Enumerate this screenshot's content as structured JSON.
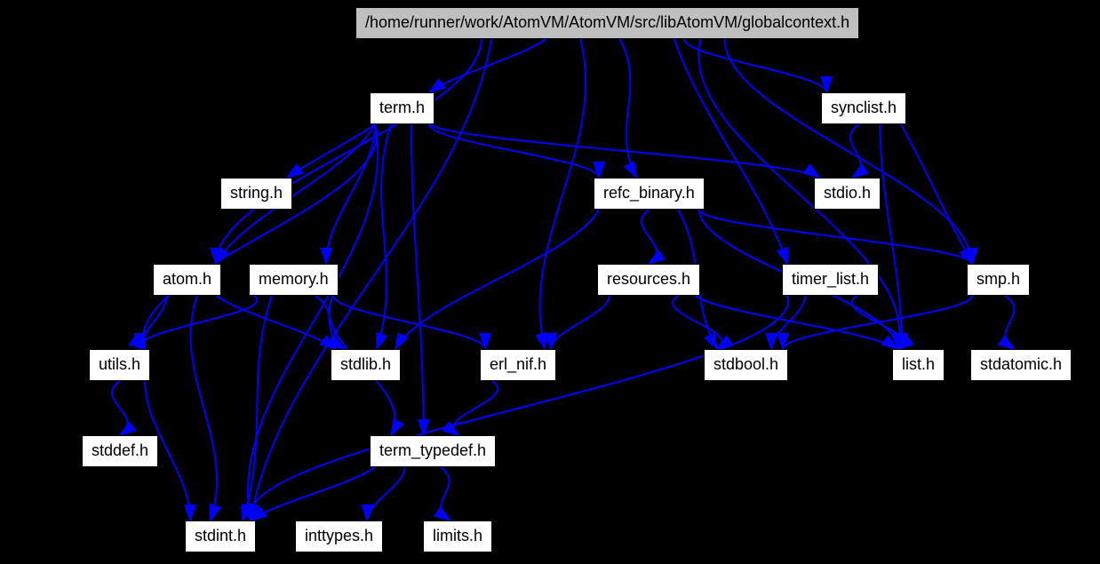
{
  "nodes": {
    "root": {
      "label": "/home/runner/work/AtomVM/AtomVM/src/libAtomVM/globalcontext.h"
    },
    "term": {
      "label": "term.h"
    },
    "synclist": {
      "label": "synclist.h"
    },
    "string": {
      "label": "string.h"
    },
    "refc_binary": {
      "label": "refc_binary.h"
    },
    "stdio": {
      "label": "stdio.h"
    },
    "atom": {
      "label": "atom.h"
    },
    "memory": {
      "label": "memory.h"
    },
    "resources": {
      "label": "resources.h"
    },
    "timer_list": {
      "label": "timer_list.h"
    },
    "smp": {
      "label": "smp.h"
    },
    "utils": {
      "label": "utils.h"
    },
    "stdlib": {
      "label": "stdlib.h"
    },
    "erl_nif": {
      "label": "erl_nif.h"
    },
    "stdbool": {
      "label": "stdbool.h"
    },
    "list": {
      "label": "list.h"
    },
    "stdatomic": {
      "label": "stdatomic.h"
    },
    "stddef": {
      "label": "stddef.h"
    },
    "term_typedef": {
      "label": "term_typedef.h"
    },
    "stdint": {
      "label": "stdint.h"
    },
    "inttypes": {
      "label": "inttypes.h"
    },
    "limits": {
      "label": "limits.h"
    }
  },
  "edges": [
    [
      "root",
      "term"
    ],
    [
      "root",
      "synclist"
    ],
    [
      "root",
      "refc_binary"
    ],
    [
      "root",
      "stdint"
    ],
    [
      "root",
      "atom"
    ],
    [
      "root",
      "erl_nif"
    ],
    [
      "root",
      "list"
    ],
    [
      "root",
      "smp"
    ],
    [
      "root",
      "timer_list"
    ],
    [
      "term",
      "string"
    ],
    [
      "term",
      "refc_binary"
    ],
    [
      "term",
      "stdio"
    ],
    [
      "term",
      "atom"
    ],
    [
      "term",
      "memory"
    ],
    [
      "term",
      "utils"
    ],
    [
      "term",
      "stdlib"
    ],
    [
      "term",
      "term_typedef"
    ],
    [
      "term",
      "stdint"
    ],
    [
      "synclist",
      "stdio"
    ],
    [
      "synclist",
      "list"
    ],
    [
      "synclist",
      "smp"
    ],
    [
      "refc_binary",
      "resources"
    ],
    [
      "refc_binary",
      "list"
    ],
    [
      "refc_binary",
      "stdbool"
    ],
    [
      "refc_binary",
      "stdlib"
    ],
    [
      "refc_binary",
      "smp"
    ],
    [
      "atom",
      "stdlib"
    ],
    [
      "atom",
      "stdint"
    ],
    [
      "atom",
      "utils"
    ],
    [
      "memory",
      "stdlib"
    ],
    [
      "memory",
      "stdint"
    ],
    [
      "memory",
      "erl_nif"
    ],
    [
      "memory",
      "utils"
    ],
    [
      "memory",
      "term_typedef"
    ],
    [
      "resources",
      "erl_nif"
    ],
    [
      "resources",
      "list"
    ],
    [
      "resources",
      "stdbool"
    ],
    [
      "timer_list",
      "stdbool"
    ],
    [
      "timer_list",
      "stdint"
    ],
    [
      "timer_list",
      "list"
    ],
    [
      "smp",
      "stdbool"
    ],
    [
      "smp",
      "stdatomic"
    ],
    [
      "utils",
      "stddef"
    ],
    [
      "utils",
      "stdint"
    ],
    [
      "erl_nif",
      "term_typedef"
    ],
    [
      "term_typedef",
      "stdint"
    ],
    [
      "term_typedef",
      "inttypes"
    ],
    [
      "term_typedef",
      "limits"
    ]
  ]
}
